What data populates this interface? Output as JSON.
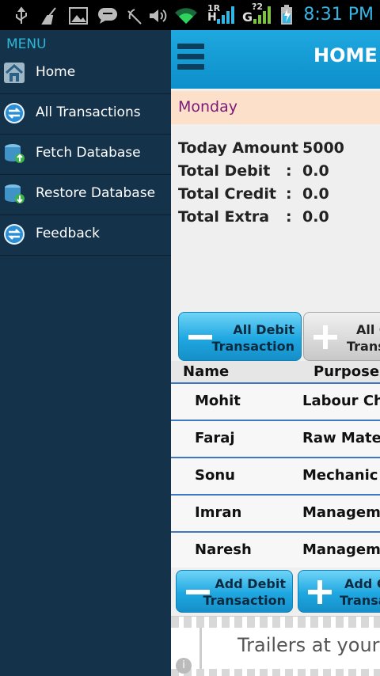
{
  "status_bar": {
    "time": "8:31 PM",
    "network_labels": [
      "1R",
      "G",
      "?2",
      "H"
    ],
    "icons": [
      "usb-icon",
      "broom-icon",
      "image-icon",
      "message-icon",
      "mute-icon",
      "volume-icon",
      "wifi-icon",
      "signal-icon",
      "signal-icon",
      "battery-icon"
    ],
    "accent": "#33b5e5"
  },
  "drawer": {
    "title": "MENU",
    "items": [
      {
        "label": "Home",
        "icon": "home-icon"
      },
      {
        "label": "All Transactions",
        "icon": "transfer-icon"
      },
      {
        "label": "Fetch Database",
        "icon": "database-upload-icon"
      },
      {
        "label": "Restore Database",
        "icon": "database-download-icon"
      },
      {
        "label": "Feedback",
        "icon": "transfer-icon"
      }
    ]
  },
  "header": {
    "title": "HOME",
    "menu_icon": "hamburger-icon"
  },
  "day": "Monday",
  "summary": [
    {
      "label": "Today Amount",
      "colon": ":",
      "value": "5000"
    },
    {
      "label": "Total Debit",
      "colon": ":",
      "value": "0.0"
    },
    {
      "label": "Total Credit",
      "colon": ":",
      "value": "0.0"
    },
    {
      "label": "Total Extra",
      "colon": ":",
      "value": "0.0"
    }
  ],
  "buttons_top": {
    "debit": {
      "line1": "All Debit",
      "line2": "Transaction"
    },
    "credit": {
      "line1": "All C",
      "line2": "Trans"
    }
  },
  "table": {
    "columns": [
      "Name",
      "Purpose"
    ],
    "rows": [
      {
        "name": "Mohit",
        "purpose": "Labour Cha"
      },
      {
        "name": "Faraj",
        "purpose": "Raw Mater"
      },
      {
        "name": "Sonu",
        "purpose": "Mechanic"
      },
      {
        "name": "Imran",
        "purpose": "Manageme"
      },
      {
        "name": "Naresh",
        "purpose": "Manageme"
      }
    ]
  },
  "buttons_bottom": {
    "debit": {
      "line1": "Add Debit",
      "line2": "Transaction"
    },
    "credit": {
      "line1": "Add C",
      "line2": "Transa"
    }
  },
  "ad": {
    "text": "Trailers at your",
    "info": "i"
  }
}
